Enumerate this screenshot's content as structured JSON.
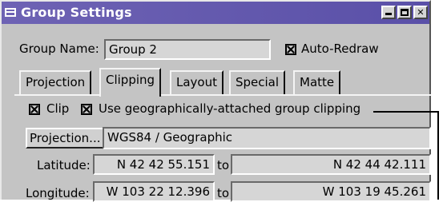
{
  "window": {
    "title": "Group Settings",
    "controls": [
      "minimize-icon",
      "maximize-icon",
      "close-icon"
    ]
  },
  "group_name": {
    "label": "Group Name:",
    "value": "Group 2"
  },
  "auto_redraw": {
    "label": "Auto-Redraw",
    "checked": true
  },
  "tabs": [
    {
      "label": "Projection",
      "active": false
    },
    {
      "label": "Clipping",
      "active": true
    },
    {
      "label": "Layout",
      "active": false
    },
    {
      "label": "Special",
      "active": false
    },
    {
      "label": "Matte",
      "active": false
    }
  ],
  "clip": {
    "label": "Clip",
    "checked": true
  },
  "geo_clip": {
    "label": "Use geographically-attached group clipping",
    "checked": true
  },
  "projection": {
    "button_label": "Projection...",
    "value": "WGS84 / Geographic"
  },
  "latitude": {
    "label": "Latitude:",
    "from": "N 42 42 55.151",
    "to_label": "to",
    "to": "N 42 44 42.111"
  },
  "longitude": {
    "label": "Longitude:",
    "from": "W 103 22 12.396",
    "to_label": "to",
    "to": "W 103 19 45.261"
  }
}
